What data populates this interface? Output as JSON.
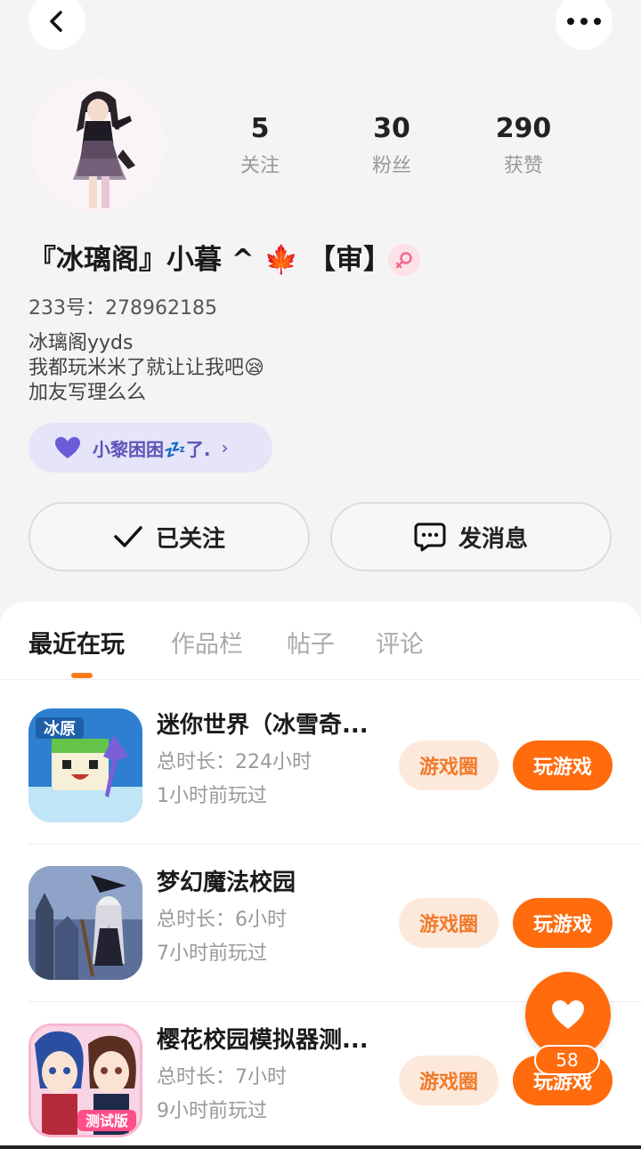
{
  "profile": {
    "username": "『冰璃阁』小暮 ^ 🍁 【审】",
    "gender_icon": "female-icon",
    "uid_label": "233号：",
    "uid_value": "278962185",
    "bio": "冰璃阁yyds\n我都玩米米了就让让我吧😪\n加友写理么么",
    "mood": "小黎困困💤了.",
    "stats": [
      {
        "value": "5",
        "label": "关注"
      },
      {
        "value": "30",
        "label": "粉丝"
      },
      {
        "value": "290",
        "label": "获赞"
      }
    ]
  },
  "actions": {
    "follow_label": "已关注",
    "message_label": "发消息"
  },
  "tabs": [
    {
      "label": "最近在玩",
      "active": true
    },
    {
      "label": "作品栏",
      "active": false
    },
    {
      "label": "帖子",
      "active": false
    },
    {
      "label": "评论",
      "active": false
    }
  ],
  "games": [
    {
      "title": "迷你世界（冰雪奇...",
      "duration": "总时长：224小时",
      "last_played": "1小时前玩过",
      "circle_label": "游戏圈",
      "play_label": "玩游戏",
      "icon_badge": "冰原"
    },
    {
      "title": "梦幻魔法校园",
      "duration": "总时长：6小时",
      "last_played": "7小时前玩过",
      "circle_label": "游戏圈",
      "play_label": "玩游戏"
    },
    {
      "title": "樱花校园模拟器测...",
      "duration": "总时长：7小时",
      "last_played": "9小时前玩过",
      "circle_label": "游戏圈",
      "play_label": "玩游戏",
      "icon_badge": "测试版"
    }
  ],
  "like_count": "58",
  "colors": {
    "accent": "#ff6b0d",
    "accent_light": "#fde9dc",
    "mood_bg": "#e5e4f8",
    "mood_text": "#5b54b8"
  }
}
